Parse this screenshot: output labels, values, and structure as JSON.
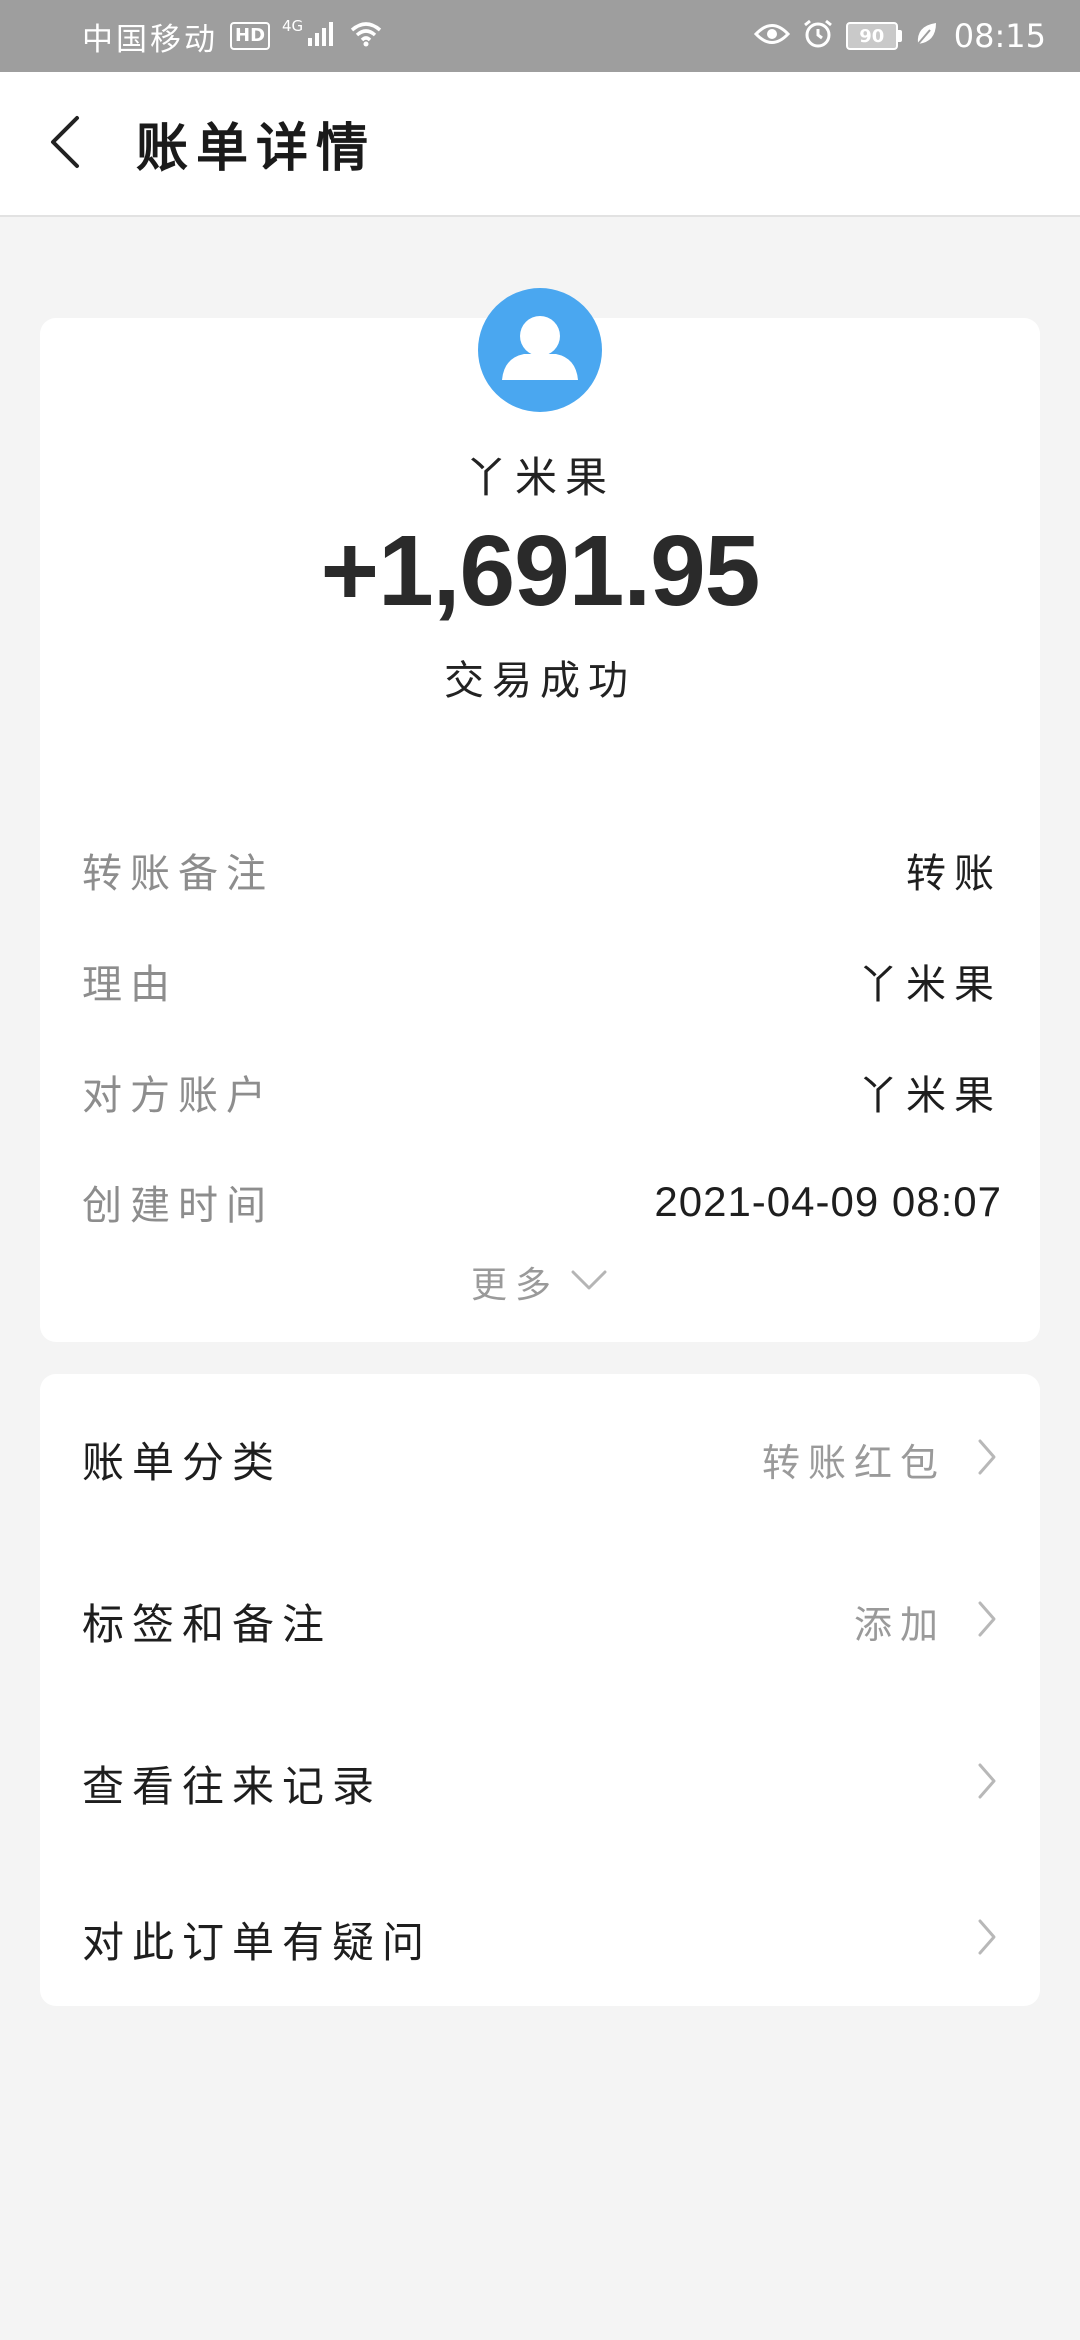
{
  "status_bar": {
    "carrier": "中国移动",
    "hd": "HD",
    "network": "4G",
    "battery": "90",
    "time": "08:15",
    "icons": [
      "signal-icon",
      "wifi-icon",
      "eye-icon",
      "alarm-icon",
      "battery-icon",
      "leaf-icon"
    ]
  },
  "header": {
    "title": "账单详情",
    "back_icon": "chevron-left-icon"
  },
  "summary": {
    "avatar_icon": "user-avatar-icon",
    "avatar_color": "#4aa7f0",
    "payee": "丫米果",
    "amount": "+1,691.95",
    "status": "交易成功"
  },
  "details": [
    {
      "label": "转账备注",
      "value": "转账"
    },
    {
      "label": "理由",
      "value": "丫米果"
    },
    {
      "label": "对方账户",
      "value": "丫米果"
    },
    {
      "label": "创建时间",
      "value": "2021-04-09 08:07"
    }
  ],
  "more": {
    "label": "更多",
    "icon": "chevron-down-icon"
  },
  "menu": [
    {
      "label": "账单分类",
      "value": "转账红包"
    },
    {
      "label": "标签和备注",
      "value": "添加"
    },
    {
      "label": "查看往来记录",
      "value": ""
    },
    {
      "label": "对此订单有疑问",
      "value": ""
    }
  ]
}
